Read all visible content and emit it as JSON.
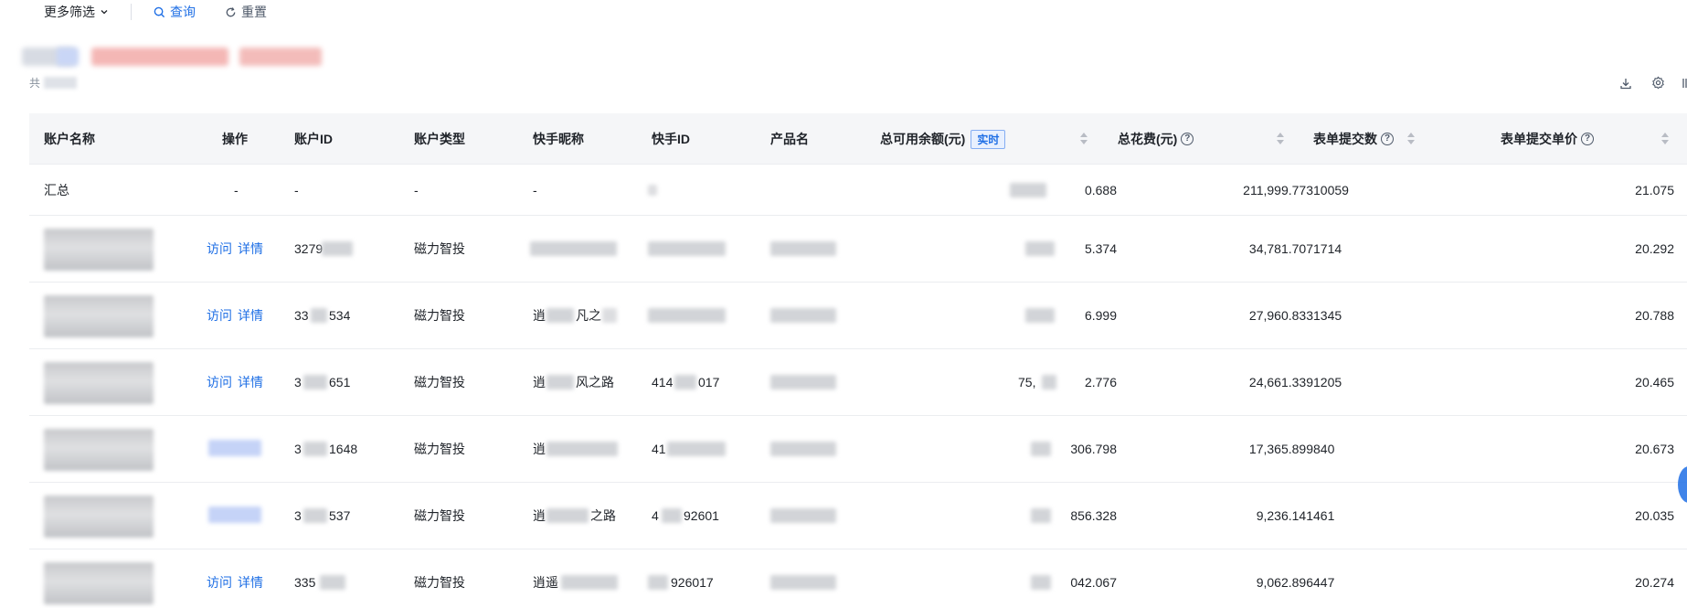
{
  "toolbar": {
    "more_filters": "更多筛选",
    "search": "查询",
    "reset": "重置"
  },
  "summary_text": "共",
  "columns": {
    "account_name": "账户名称",
    "operation": "操作",
    "account_id": "账户ID",
    "account_type": "账户类型",
    "ks_nickname": "快手昵称",
    "ks_id": "快手ID",
    "product_name": "产品名",
    "balance": "总可用余额(元)",
    "realtime_badge": "实时",
    "total_cost": "总花费(元)",
    "form_count": "表单提交数",
    "form_unit_price": "表单提交单价"
  },
  "summary_row": {
    "account_name": "汇总",
    "operation": "-",
    "account_id": "-",
    "account_type": "-",
    "ks_nickname": "-",
    "balance": "0.688",
    "total_cost": "211,999.773",
    "form_count": "10059",
    "form_unit_price": "21.075"
  },
  "row_actions": {
    "visit": "访问",
    "detail": "详情"
  },
  "rows": [
    {
      "account_id": "3279",
      "account_type": "磁力智投",
      "ks_nickname": "",
      "ks_id": "",
      "balance": "5.374",
      "total_cost": "34,781.707",
      "form_count": "1714",
      "form_unit_price": "20.292",
      "actions_visible": true
    },
    {
      "account_id": "33",
      "account_id_tail": "534",
      "account_type": "磁力智投",
      "ks_nickname": "逍",
      "ks_nickname_mid": "凡之",
      "ks_id": "",
      "balance": "6.999",
      "total_cost": "27,960.833",
      "form_count": "1345",
      "form_unit_price": "20.788",
      "actions_visible": true
    },
    {
      "account_id": "3",
      "account_id_tail": "651",
      "account_type": "磁力智投",
      "ks_nickname": "逍",
      "ks_nickname_mid": "风之路",
      "ks_id": "414",
      "ks_id_tail": "017",
      "balance_head": "75,",
      "balance": "2.776",
      "total_cost": "24,661.339",
      "form_count": "1205",
      "form_unit_price": "20.465",
      "actions_visible": true
    },
    {
      "account_id": "3",
      "account_id_tail": "1648",
      "account_type": "磁力智投",
      "ks_nickname": "逍",
      "ks_id": "41",
      "balance": "306.798",
      "total_cost": "17,365.899",
      "form_count": "840",
      "form_unit_price": "20.673",
      "actions_visible": false
    },
    {
      "account_id": "3",
      "account_id_tail": "537",
      "account_type": "磁力智投",
      "ks_nickname": "逍",
      "ks_nickname_mid": "之路",
      "ks_id": "4",
      "ks_id_tail": "92601",
      "balance": "856.328",
      "total_cost": "9,236.141",
      "form_count": "461",
      "form_unit_price": "20.035",
      "actions_visible": false
    },
    {
      "account_id": "335",
      "account_type": "磁力智投",
      "ks_nickname": "逍遥",
      "ks_id": "",
      "ks_id_tail": "926017",
      "balance": "042.067",
      "total_cost": "9,062.896",
      "form_count": "447",
      "form_unit_price": "20.274",
      "actions_visible": true
    }
  ]
}
